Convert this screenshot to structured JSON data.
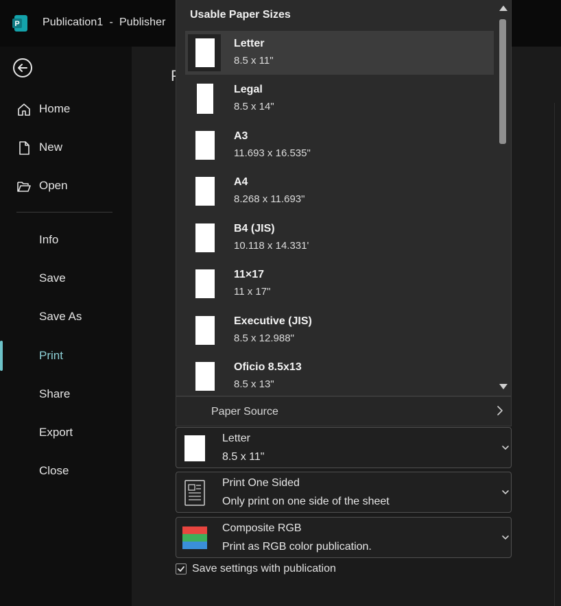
{
  "titlebar": {
    "title": "Publication1  -  Publisher",
    "app_icon": "publisher-icon",
    "app_icon_letter": "P"
  },
  "sidebar": {
    "back_icon": "back-arrow-icon",
    "items": [
      {
        "label": "Home",
        "icon": "home-icon"
      },
      {
        "label": "New",
        "icon": "new-document-icon"
      },
      {
        "label": "Open",
        "icon": "folder-open-icon"
      },
      {
        "label": "Info"
      },
      {
        "label": "Save"
      },
      {
        "label": "Save As"
      },
      {
        "label": "Print",
        "active": true
      },
      {
        "label": "Share"
      },
      {
        "label": "Export"
      },
      {
        "label": "Close"
      }
    ]
  },
  "content": {
    "title_fragment": "P"
  },
  "paper_dropdown": {
    "header": "Usable Paper Sizes",
    "items": [
      {
        "name": "Letter",
        "dims": "8.5 x 11\"",
        "selected": true
      },
      {
        "name": "Legal",
        "dims": "8.5 x 14\""
      },
      {
        "name": "A3",
        "dims": "11.693 x 16.535\""
      },
      {
        "name": "A4",
        "dims": "8.268 x 11.693\""
      },
      {
        "name": "B4 (JIS)",
        "dims": "10.118 x 14.331'"
      },
      {
        "name": "11×17",
        "dims": "11 x 17\""
      },
      {
        "name": "Executive (JIS)",
        "dims": "8.5 x 12.988\""
      },
      {
        "name": "Oficio 8.5x13",
        "dims": "8.5 x 13\""
      }
    ],
    "paper_source": "Paper Source"
  },
  "options": {
    "paper": {
      "line1": "Letter",
      "line2": "8.5 x 11\""
    },
    "sides": {
      "line1": "Print One Sided",
      "line2": "Only print on one side of the sheet"
    },
    "color": {
      "line1": "Composite RGB",
      "line2": "Print as RGB color publication."
    }
  },
  "save_settings": {
    "label": "Save settings with publication",
    "checked": true
  },
  "colors": {
    "accent": "#6dc3c9",
    "rgb_red": "#e8453f",
    "rgb_green": "#3fae5a",
    "rgb_blue": "#3a8fd9",
    "app_icon": "#0e7a82"
  }
}
